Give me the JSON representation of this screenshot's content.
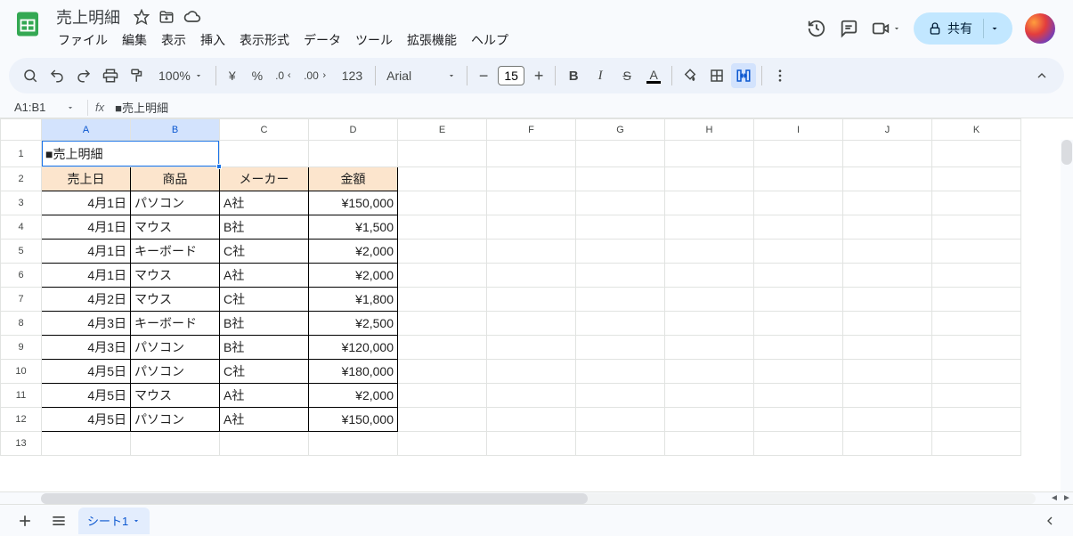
{
  "doc": {
    "title": "売上明細"
  },
  "menus": [
    "ファイル",
    "編集",
    "表示",
    "挿入",
    "表示形式",
    "データ",
    "ツール",
    "拡張機能",
    "ヘルプ"
  ],
  "toolbar": {
    "zoom": "100%",
    "currency": "¥",
    "percent": "%",
    "dec_dec": ".0",
    "inc_dec": ".00",
    "num_fmt": "123",
    "font": "Arial",
    "font_size": "15"
  },
  "share": {
    "label": "共有"
  },
  "name_box": "A1:B1",
  "formula": "■売上明細",
  "columns": [
    "A",
    "B",
    "C",
    "D",
    "E",
    "F",
    "G",
    "H",
    "I",
    "J",
    "K"
  ],
  "sheet": {
    "title_cell": "■売上明細",
    "headers": [
      "売上日",
      "商品",
      "メーカー",
      "金額"
    ],
    "rows": [
      {
        "date": "4月1日",
        "product": "パソコン",
        "maker": "A社",
        "amount": "¥150,000"
      },
      {
        "date": "4月1日",
        "product": "マウス",
        "maker": "B社",
        "amount": "¥1,500"
      },
      {
        "date": "4月1日",
        "product": "キーボード",
        "maker": "C社",
        "amount": "¥2,000"
      },
      {
        "date": "4月1日",
        "product": "マウス",
        "maker": "A社",
        "amount": "¥2,000"
      },
      {
        "date": "4月2日",
        "product": "マウス",
        "maker": "C社",
        "amount": "¥1,800"
      },
      {
        "date": "4月3日",
        "product": "キーボード",
        "maker": "B社",
        "amount": "¥2,500"
      },
      {
        "date": "4月3日",
        "product": "パソコン",
        "maker": "B社",
        "amount": "¥120,000"
      },
      {
        "date": "4月5日",
        "product": "パソコン",
        "maker": "C社",
        "amount": "¥180,000"
      },
      {
        "date": "4月5日",
        "product": "マウス",
        "maker": "A社",
        "amount": "¥2,000"
      },
      {
        "date": "4月5日",
        "product": "パソコン",
        "maker": "A社",
        "amount": "¥150,000"
      }
    ]
  },
  "tabs": {
    "active": "シート1"
  }
}
